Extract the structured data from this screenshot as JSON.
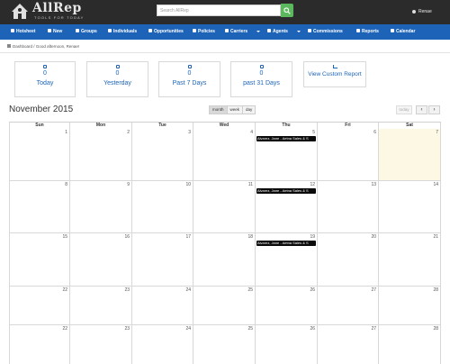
{
  "brand": {
    "name": "AllRep",
    "tagline": "TOOLS FOR TODAY"
  },
  "search": {
    "placeholder": "Search AllRep"
  },
  "user": {
    "name": "Renae"
  },
  "colors": {
    "nav": "#1d64b8",
    "topbar": "#2b2b2b",
    "search_button": "#5cb85c",
    "today_cell": "#fcf8e3",
    "event": "#0a0a0a"
  },
  "nav": [
    {
      "label": "Hotsheet",
      "icon": "fire-icon"
    },
    {
      "label": "New",
      "icon": "plus-icon"
    },
    {
      "label": "Groups",
      "icon": "group-icon"
    },
    {
      "label": "Individuals",
      "icon": "user-icon"
    },
    {
      "label": "Opportunities",
      "icon": "target-icon"
    },
    {
      "label": "Policies",
      "icon": "shield-icon"
    },
    {
      "label": "Carriers",
      "icon": "briefcase-icon"
    },
    {
      "label": "Agents",
      "icon": "users-icon"
    },
    {
      "label": "Commissions",
      "icon": "money-icon"
    },
    {
      "label": "Reports",
      "icon": "chart-icon"
    },
    {
      "label": "Calendar",
      "icon": "calendar-icon"
    }
  ],
  "breadcrumb": {
    "home": "Dashboard",
    "separator": "/",
    "greeting": "Good afternoon, Renae!"
  },
  "stats": [
    {
      "value": "0",
      "label": "Today"
    },
    {
      "value": "0",
      "label": "Yesterday"
    },
    {
      "value": "0",
      "label": "Past 7 Days"
    },
    {
      "value": "0",
      "label": "past 31 Days"
    }
  ],
  "custom_report": {
    "label": "View Custom Report"
  },
  "calendar": {
    "title": "November 2015",
    "views": [
      "month",
      "week",
      "day"
    ],
    "active_view": "month",
    "today_label": "today",
    "prev": "‹",
    "next": "›",
    "weekdays": [
      "Sun",
      "Mon",
      "Tue",
      "Wed",
      "Thu",
      "Fri",
      "Sat"
    ],
    "weeks": [
      [
        "1",
        "2",
        "3",
        "4",
        "5",
        "6",
        "7"
      ],
      [
        "8",
        "9",
        "10",
        "11",
        "12",
        "13",
        "14"
      ],
      [
        "15",
        "16",
        "17",
        "18",
        "19",
        "20",
        "21"
      ],
      [
        "22",
        "23",
        "24",
        "25",
        "26",
        "27",
        "28"
      ],
      [
        "22",
        "23",
        "24",
        "25",
        "26",
        "27",
        "28"
      ]
    ],
    "today": {
      "week": 0,
      "day": 6
    },
    "events": [
      {
        "week": 0,
        "day": 4,
        "title": "Alvarez, Jane - Aetna Sales & S"
      },
      {
        "week": 1,
        "day": 4,
        "title": "Alvarez, Jane - Aetna Sales & S"
      },
      {
        "week": 2,
        "day": 4,
        "title": "Alvarez, Jane - Aetna Sales & S"
      }
    ]
  }
}
